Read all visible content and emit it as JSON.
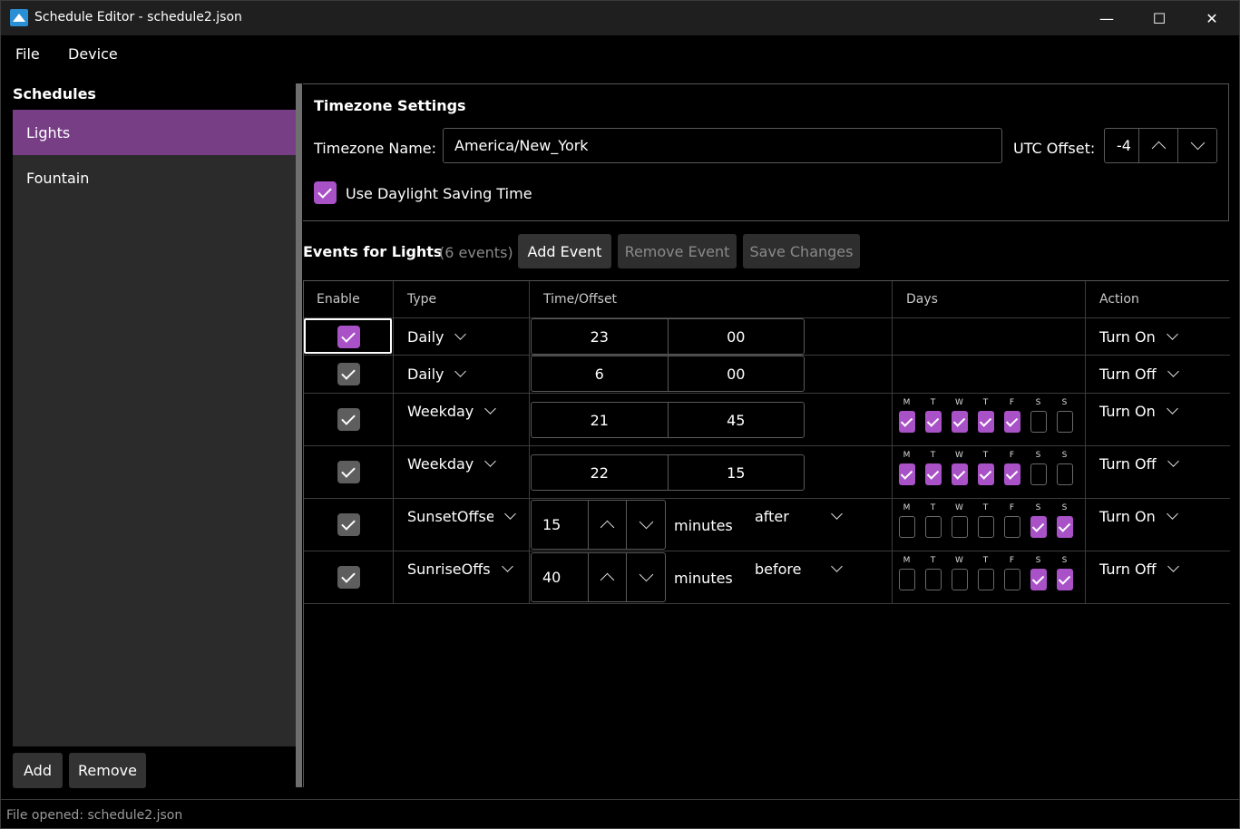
{
  "window": {
    "title": "Schedule Editor - schedule2.json",
    "minimize": "—",
    "maximize": "☐",
    "close": "✕"
  },
  "menu": {
    "file": "File",
    "device": "Device"
  },
  "sidebar": {
    "title": "Schedules",
    "items": [
      {
        "label": "Lights",
        "selected": true
      },
      {
        "label": "Fountain",
        "selected": false
      }
    ],
    "add_label": "Add",
    "remove_label": "Remove"
  },
  "timezone": {
    "title": "Timezone Settings",
    "name_label": "Timezone Name:",
    "name_value": "America/New_York",
    "utc_label": "UTC Offset:",
    "utc_value": "-4",
    "dst_label": "Use Daylight Saving Time",
    "dst_checked": true
  },
  "events": {
    "title": "Events for Lights",
    "count": "(6 events)",
    "add_label": "Add Event",
    "remove_label": "Remove Event",
    "save_label": "Save Changes",
    "headers": {
      "enable": "Enable",
      "type": "Type",
      "time": "Time/Offset",
      "days": "Days",
      "action": "Action"
    },
    "day_letters": [
      "M",
      "T",
      "W",
      "T",
      "F",
      "S",
      "S"
    ],
    "offset_unit": "minutes",
    "rows": [
      {
        "enabled": true,
        "type": "Daily",
        "hour": "23",
        "minute": "00",
        "action": "Turn On"
      },
      {
        "enabled": true,
        "type": "Daily",
        "hour": "6",
        "minute": "00",
        "action": "Turn Off"
      },
      {
        "enabled": true,
        "type": "Weekday",
        "hour": "21",
        "minute": "45",
        "days": [
          true,
          true,
          true,
          true,
          true,
          false,
          false
        ],
        "action": "Turn On"
      },
      {
        "enabled": true,
        "type": "Weekday",
        "hour": "22",
        "minute": "15",
        "days": [
          true,
          true,
          true,
          true,
          true,
          false,
          false
        ],
        "action": "Turn Off"
      },
      {
        "enabled": true,
        "type": "SunsetOffse",
        "offset": "15",
        "direction": "after",
        "days": [
          false,
          false,
          false,
          false,
          false,
          true,
          true
        ],
        "action": "Turn On"
      },
      {
        "enabled": true,
        "type": "SunriseOffs",
        "offset": "40",
        "direction": "before",
        "days": [
          false,
          false,
          false,
          false,
          false,
          true,
          true
        ],
        "action": "Turn Off"
      }
    ]
  },
  "status": "File opened: schedule2.json",
  "colors": {
    "accent": "#a951c7",
    "selection": "#773e86",
    "background": "#000000"
  }
}
